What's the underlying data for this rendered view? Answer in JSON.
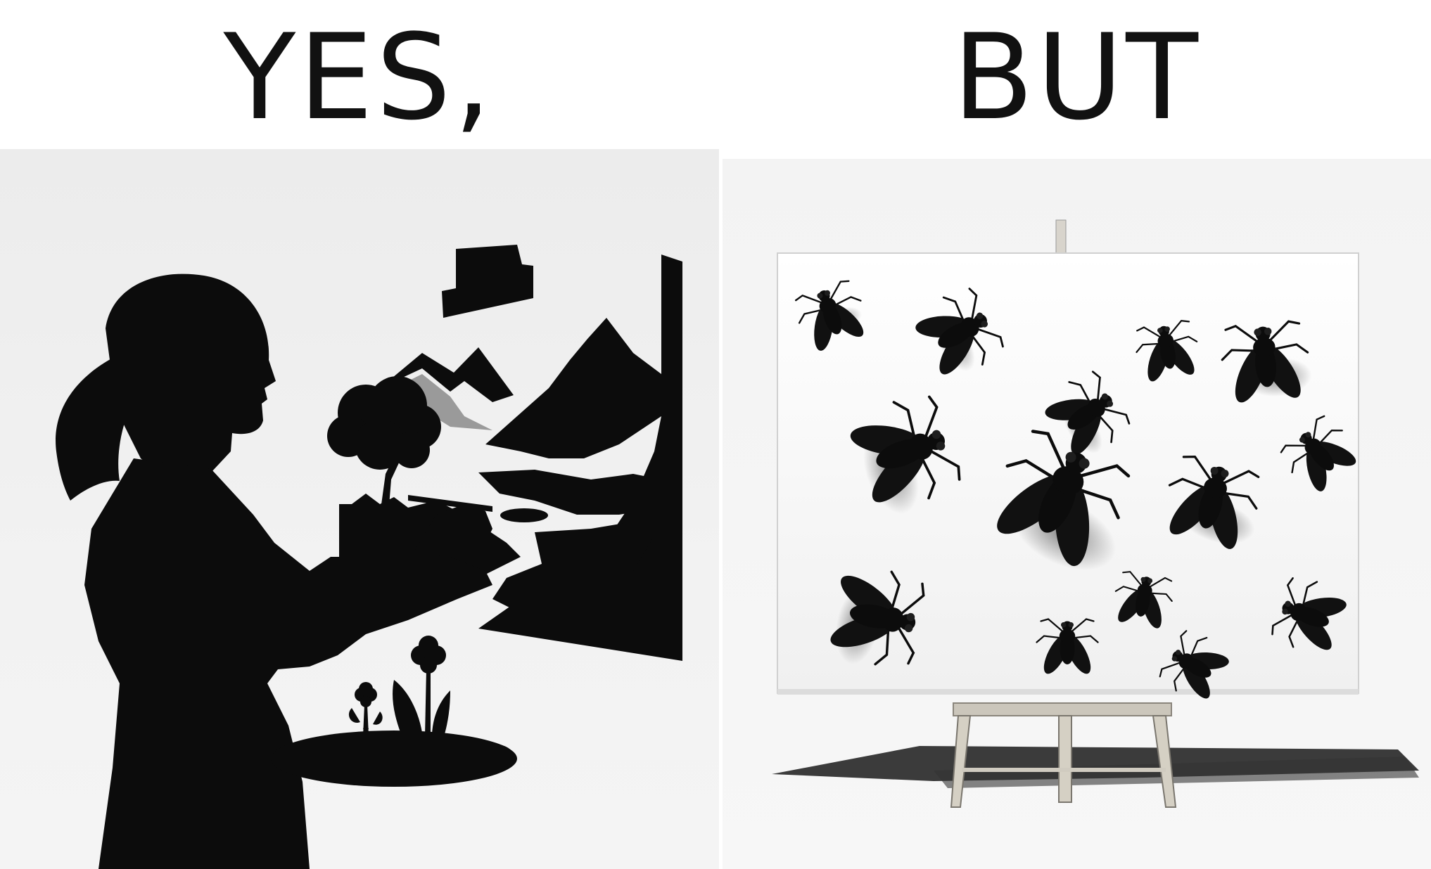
{
  "captions": {
    "left": "YES,",
    "right": "BUT"
  },
  "panels": {
    "left": {
      "icons": [
        "woman-silhouette-icon",
        "landscape-painting-icon",
        "palette-icon",
        "brush-icon"
      ]
    },
    "right": {
      "icons": [
        "canvas-icon",
        "easel-icon",
        "fly-icon"
      ]
    }
  },
  "colors": {
    "ink": "#0c0c0c",
    "background": "#ffffff"
  }
}
